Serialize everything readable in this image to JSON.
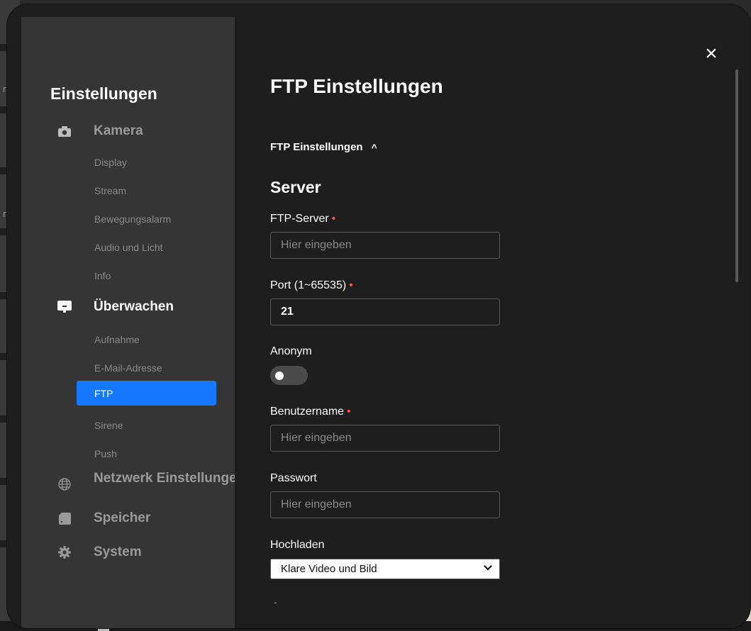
{
  "modal": {
    "close_label": "×"
  },
  "sidebar": {
    "title": "Einstellungen",
    "categories": [
      {
        "label": "Kamera",
        "icon": "camera-icon"
      },
      {
        "label": "Überwachen",
        "icon": "monitor-icon"
      },
      {
        "label": "Netzwerk Einstellungen",
        "icon": "globe-icon"
      },
      {
        "label": "Speicher",
        "icon": "sd-card-icon"
      },
      {
        "label": "System",
        "icon": "gear-icon"
      }
    ],
    "kamera_items": [
      "Display",
      "Stream",
      "Bewegungsalarm",
      "Audio und Licht",
      "Info"
    ],
    "ueberwachen_items": [
      "Aufnahme",
      "E-Mail-Adresse",
      "FTP",
      "Sirene",
      "Push"
    ],
    "active_item": "FTP"
  },
  "main": {
    "page_title": "FTP Einstellungen",
    "section_label": "FTP Einstellungen",
    "section_chevron": "^",
    "server_title": "Server",
    "ftp_server": {
      "label": "FTP-Server",
      "required_mark": "•",
      "placeholder": "Hier eingeben"
    },
    "port": {
      "label": "Port (1~65535)",
      "required_mark": "•",
      "value": "21"
    },
    "anonym": {
      "label": "Anonym",
      "enabled": false
    },
    "benutzername": {
      "label": "Benutzername",
      "required_mark": "•",
      "placeholder": "Hier eingeben"
    },
    "passwort": {
      "label": "Passwort",
      "placeholder": "Hier eingeben"
    },
    "hochladen": {
      "label": "Hochladen",
      "selected": "Klare Video und Bild",
      "caret": "⌄"
    },
    "trailing": "-"
  },
  "background": {
    "text_1": "rt",
    "text_2": "rt"
  },
  "colors": {
    "accent": "#1677ff",
    "required": "#ff4d4f",
    "sidebar_bg": "#353535",
    "main_bg": "#1e1e1e"
  }
}
